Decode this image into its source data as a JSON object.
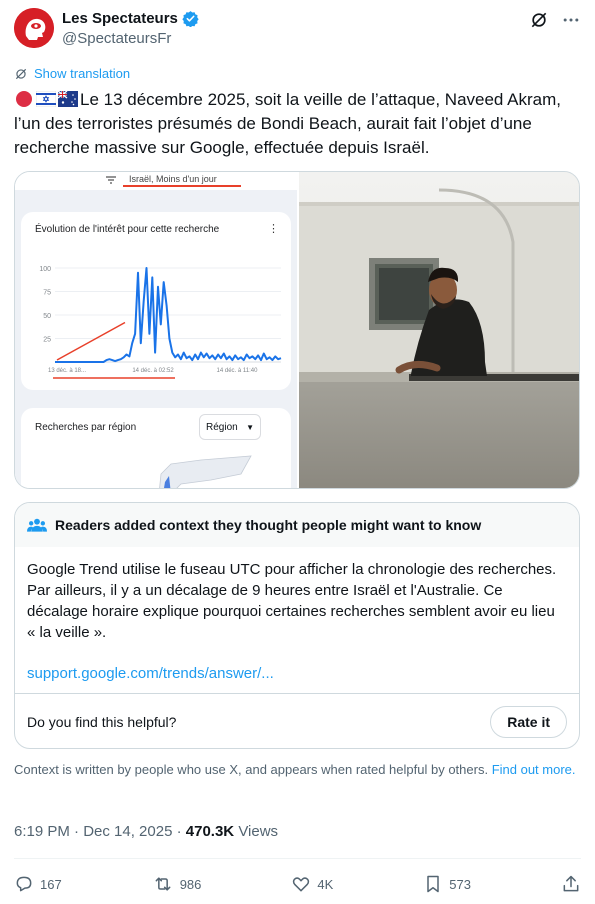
{
  "author": {
    "name": "Les Spectateurs",
    "handle": "@SpectateursFr"
  },
  "translate_label": "Show translation",
  "tweet": {
    "text": "Le 13 décembre 2025, soit la veille de l’attaque, Naveed Akram, l’un des terroristes présumés de Bondi Beach, aurait fait l’objet d’une recherche massive sur Google, effectuée depuis Israël."
  },
  "media": {
    "trends": {
      "filter_label": "Israël, Moins d'un jour",
      "interest_title": "Évolution de l'intérêt pour cette recherche",
      "region_title": "Recherches par région",
      "region_select": "Région",
      "chart_data": {
        "type": "line",
        "ylim": [
          0,
          100
        ],
        "y_ticks": [
          "100",
          "75",
          "50",
          "25"
        ],
        "x_ticks": [
          "13 déc. à 18...",
          "14 déc. à 02:52",
          "14 déc. à 11:40"
        ],
        "values": [
          0,
          0,
          0,
          0,
          0,
          0,
          0,
          0,
          0,
          0,
          0,
          0,
          0,
          0,
          0,
          0,
          0,
          0,
          2,
          3,
          2,
          1,
          2,
          3,
          5,
          8,
          6,
          20,
          30,
          95,
          20,
          65,
          100,
          30,
          90,
          10,
          80,
          40,
          85,
          60,
          25,
          10,
          5,
          8,
          3,
          10,
          4,
          6,
          2,
          8,
          3,
          10,
          5,
          9,
          4,
          7,
          3,
          8,
          4,
          9,
          3,
          6,
          2,
          7,
          3,
          5,
          2,
          8,
          4,
          6,
          3,
          7,
          2,
          9,
          3,
          5,
          2,
          6,
          3,
          4
        ],
        "color": "#1a73e8",
        "annotation_color": "#e8402a"
      }
    }
  },
  "context": {
    "header": "Readers added context they thought people might want to know",
    "body": "Google Trend utilise le fuseau UTC pour afficher la chronologie des recherches. Par ailleurs, il y a un décalage de 9 heures entre Israël et l'Australie. Ce décalage horaire explique pourquoi certaines recherches semblent avoir eu lieu « la veille ».",
    "link": "support.google.com/trends/answer/...",
    "helpful_question": "Do you find this helpful?",
    "rate_label": "Rate it"
  },
  "note": {
    "text": "Context is written by people who use X, and appears when rated helpful by others.",
    "link": "Find out more."
  },
  "meta": {
    "time": "6:19 PM · Dec 14, 2025 ·",
    "views_count": "470.3K",
    "views_label": "Views"
  },
  "actions": {
    "replies": "167",
    "reposts": "986",
    "likes": "4K",
    "bookmarks": "573"
  },
  "colors": {
    "accent": "#1d9bf0",
    "brand_red": "#d61f26",
    "text_secondary": "#536471"
  }
}
